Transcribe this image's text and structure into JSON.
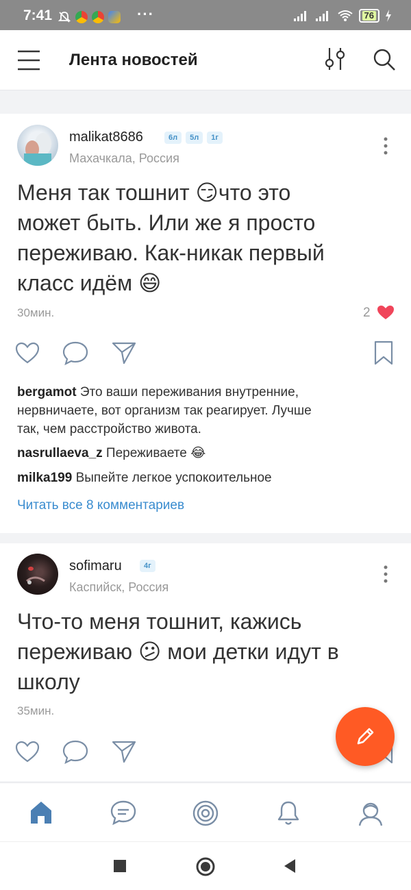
{
  "status_bar": {
    "time": "7:41",
    "more": "···",
    "battery": "76"
  },
  "header": {
    "title": "Лента новостей",
    "menu_icon": "hamburger-menu-icon",
    "filter_icon": "filter-sliders-icon",
    "search_icon": "search-icon"
  },
  "posts": [
    {
      "username": "malikat8686",
      "badges": [
        "6л",
        "5л",
        "1г"
      ],
      "location": "Махачкала, Россия",
      "text_line1": "Меня так тошнит 😏что это",
      "text_line2": "может быть. Или же я просто",
      "text_line3": "переживаю. Как-никак первый",
      "text_line4": "класс идём 😄",
      "time": "30мин.",
      "likes": "2",
      "comments": [
        {
          "user": "bergamot",
          "text": "Это ваши переживания внутренние,",
          "text2": "нервничаете, вот организм так реагирует. Лучше",
          "text3": "так, чем расстройство живота."
        },
        {
          "user": "nasrullaeva_z",
          "text": "Переживаете 😂"
        },
        {
          "user": "milka199",
          "text": "Выпейте легкое успокоительное"
        }
      ],
      "read_all": "Читать все 8 комментариев"
    },
    {
      "username": "sofimaru",
      "badges": [
        "4г"
      ],
      "location": "Каспийск, Россия",
      "text_line1": "Что-то меня тошнит, кажись",
      "text_line2": "переживаю 😕 мои детки идут в",
      "text_line3": "школу",
      "time": "35мин."
    }
  ],
  "colors": {
    "accent_blue": "#3a8ccf",
    "fab_orange": "#ff5a24",
    "like_red": "#f0455a",
    "nav_active": "#4b7fb3"
  },
  "bottom_nav": [
    "home-icon",
    "messages-icon",
    "target-icon",
    "bell-icon",
    "profile-icon"
  ],
  "system_nav": [
    "square-recent-icon",
    "circle-home-icon",
    "triangle-back-icon"
  ]
}
